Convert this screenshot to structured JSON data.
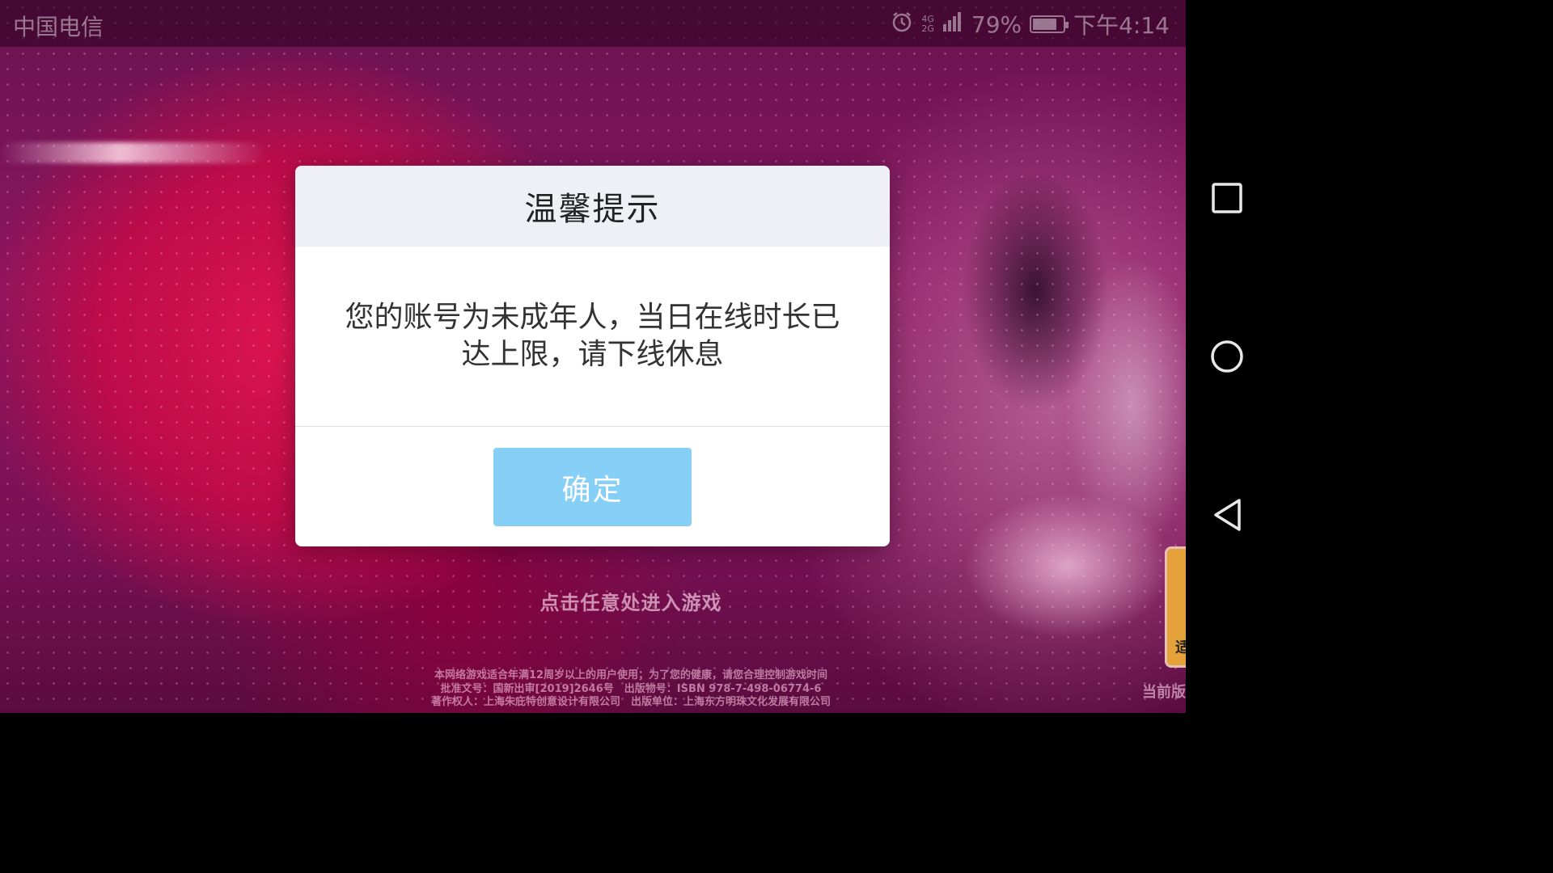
{
  "status_bar": {
    "carrier": "中国电信",
    "network_top": "4G",
    "network_bottom": "2G",
    "battery_percent": "79%",
    "battery_level": 0.79,
    "time": "下午4:14"
  },
  "dialog": {
    "title": "温馨提示",
    "message_line1": "您的账号为未成年人，当日在线时长已",
    "message_line2": "达上限，请下线休息",
    "confirm_label": "确定",
    "confirm_color": "#86cff7"
  },
  "game": {
    "enter_prompt": "点击任意处进入游戏",
    "legal_line1": "本网络游戏适合年满12周岁以上的用户使用；为了您的健康，请您合理控制游戏时间",
    "legal_line2": "批准文号：国新出审[2019]2646号　出版物号：ISBN 978-7-498-06774-6",
    "legal_line3": "著作权人：上海朱庇特创意设计有限公司　出版单位：上海东方明珠文化发展有限公司",
    "age_badge_text": "适",
    "version_text": "当前版"
  },
  "navbar": {
    "icons": [
      "recent-apps-icon",
      "home-icon",
      "back-icon"
    ]
  }
}
